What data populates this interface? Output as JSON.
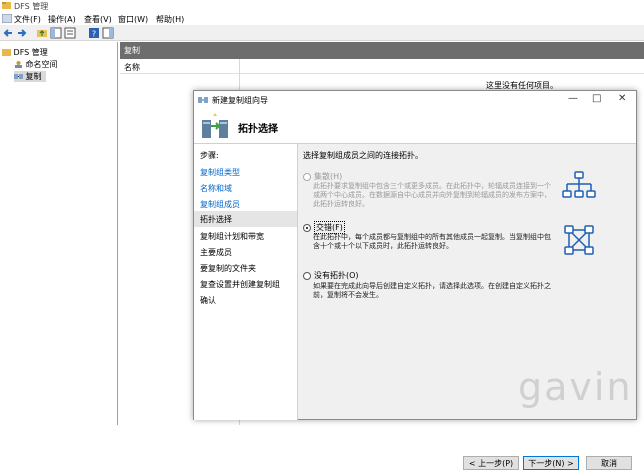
{
  "app": {
    "title": "DFS 管理"
  },
  "menu": [
    "文件(F)",
    "操作(A)",
    "查看(V)",
    "窗口(W)",
    "帮助(H)"
  ],
  "tree": {
    "root": "DFS 管理",
    "items": [
      "命名空间",
      "复制"
    ]
  },
  "pane": {
    "header": "复制",
    "column": "名称",
    "empty_text": "这里没有任何项目。"
  },
  "wizard": {
    "title": "新建复制组向导",
    "header": "拓扑选择",
    "steps_title": "步骤:",
    "steps": [
      "复制组类型",
      "名称和域",
      "复制组成员",
      "拓扑选择",
      "复制组计划和带宽",
      "主要成员",
      "要复制的文件夹",
      "复查设置并创建复制组",
      "确认"
    ],
    "intro": "选择复制组成员之间的连接拓扑。",
    "options": [
      {
        "label": "集散(H)",
        "desc": "此拓扑要求复制组中包含三个或更多成员。在此拓扑中，轮辐成员连接到一个或两个中心成员。在数据源自中心成员并向外复制到轮辐成员的发布方案中，此拓扑运转良好。",
        "enabled": false,
        "selected": false
      },
      {
        "label": "交错(F)",
        "desc": "在此拓扑中，每个成员都与复制组中的所有其他成员一起复制。当复制组中包含十个或十个以下成员时，此拓扑运转良好。",
        "enabled": true,
        "selected": true
      },
      {
        "label": "没有拓扑(O)",
        "desc": "如果要在完成此向导后创建自定义拓扑，请选择此选项。在创建自定义拓扑之前，复制将不会发生。",
        "enabled": true,
        "selected": false
      }
    ],
    "buttons": {
      "back": "< 上一步(P)",
      "next": "下一步(N) >",
      "cancel": "取消"
    }
  },
  "watermark": "gavin",
  "colors": {
    "pane_header": "#6d6d6d",
    "accent": "#0078d7"
  }
}
